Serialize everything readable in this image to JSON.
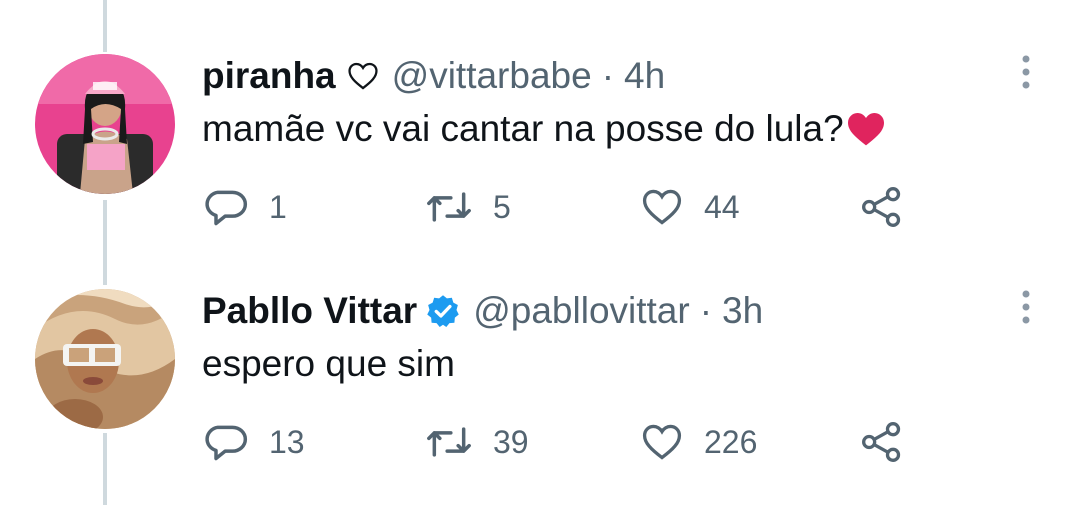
{
  "tweets": [
    {
      "display_name": "piranha",
      "name_suffix_icon": "heart-outline-icon",
      "handle": "@vittarbabe",
      "separator": "·",
      "time": "4h",
      "text": "mamãe vc vai cantar na posse do lula?",
      "text_emoji": "red-heart-emoji",
      "replies": "1",
      "retweets": "5",
      "likes": "44"
    },
    {
      "display_name": "Pabllo Vittar",
      "name_suffix_icon": "verified-badge-icon",
      "handle": "@pabllovittar",
      "separator": "·",
      "time": "3h",
      "text": "espero que sim",
      "replies": "13",
      "retweets": "39",
      "likes": "226"
    }
  ],
  "colors": {
    "text_primary": "#0f1419",
    "text_secondary": "#536471",
    "thread_line": "#cfd9de",
    "verified_blue": "#1d9bf0",
    "heart_red": "#e0245e"
  }
}
